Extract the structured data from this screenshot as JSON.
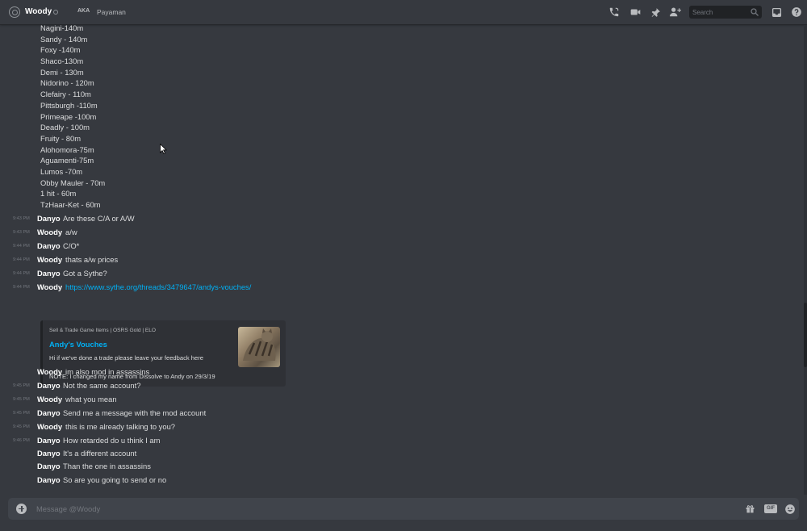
{
  "header": {
    "recipient_name": "Woody",
    "aka_badge": "AKA",
    "aka_name": "Payaman",
    "search_placeholder": "Search"
  },
  "price_list": [
    "Nagini-140m",
    "Sandy - 140m",
    "Foxy -140m",
    "Shaco-130m",
    "Demi - 130m",
    "Nidorino - 120m",
    "Clefairy - 110m",
    "Pittsburgh -110m",
    "Primeape -100m",
    "Deadly - 100m",
    "Fruity - 80m",
    "Alohomora-75m",
    "Aguamenti-75m",
    "Lumos -70m",
    "Obby Mauler - 70m",
    "1 hit - 60m",
    "TzHaar-Ket - 60m"
  ],
  "messages": [
    {
      "time": "9:43 PM",
      "author": "Danyo",
      "text": "Are these C/A or A/W"
    },
    {
      "time": "9:43 PM",
      "author": "Woody",
      "text": "a/w"
    },
    {
      "time": "9:44 PM",
      "author": "Danyo",
      "text": "C/O*"
    },
    {
      "time": "9:44 PM",
      "author": "Woody",
      "text": "thats a/w prices"
    },
    {
      "time": "9:44 PM",
      "author": "Danyo",
      "text": "Got a Sythe?"
    },
    {
      "time": "9:44 PM",
      "author": "Woody",
      "text": "https://www.sythe.org/threads/3479647/andys-vouches/"
    },
    {
      "time": "",
      "author": "Woody",
      "text": "im also mod in assassins"
    },
    {
      "time": "9:45 PM",
      "author": "Danyo",
      "text": "Not the same account?"
    },
    {
      "time": "9:45 PM",
      "author": "Woody",
      "text": "what you mean"
    },
    {
      "time": "9:45 PM",
      "author": "Danyo",
      "text": "Send me a message with the mod account"
    },
    {
      "time": "9:45 PM",
      "author": "Woody",
      "text": "this is me already talking to you?"
    },
    {
      "time": "9:46 PM",
      "author": "Danyo",
      "text": "How retarded do u think I am"
    },
    {
      "time": "",
      "author": "Danyo",
      "text": "It's a different account"
    },
    {
      "time": "",
      "author": "Danyo",
      "text": "Than the one in assassins"
    },
    {
      "time": "",
      "author": "Danyo",
      "text": "So are you going to send or no"
    }
  ],
  "embed": {
    "provider": "Sell & Trade Game Items | OSRS Gold | ELO",
    "title": "Andy's Vouches",
    "description_1": "Hi if we've done a trade please leave your feedback here",
    "description_2": "NOTE: I changed my name from Dissolve to Andy on 29/3/19"
  },
  "composer": {
    "placeholder": "Message @Woody",
    "gif_label": "GIF"
  },
  "colors": {
    "background": "#36393f",
    "link": "#00b0f4",
    "author": "#ffffff",
    "embed_background": "#2f3136",
    "composer_background": "#40444b"
  },
  "icons": [
    "at-icon",
    "status-icon",
    "call-icon",
    "video-icon",
    "pin-icon",
    "add-friend-icon",
    "search-icon",
    "inbox-icon",
    "help-icon",
    "add-attachment-icon",
    "gift-icon",
    "gif-icon",
    "emoji-icon",
    "mouse-cursor-icon"
  ]
}
